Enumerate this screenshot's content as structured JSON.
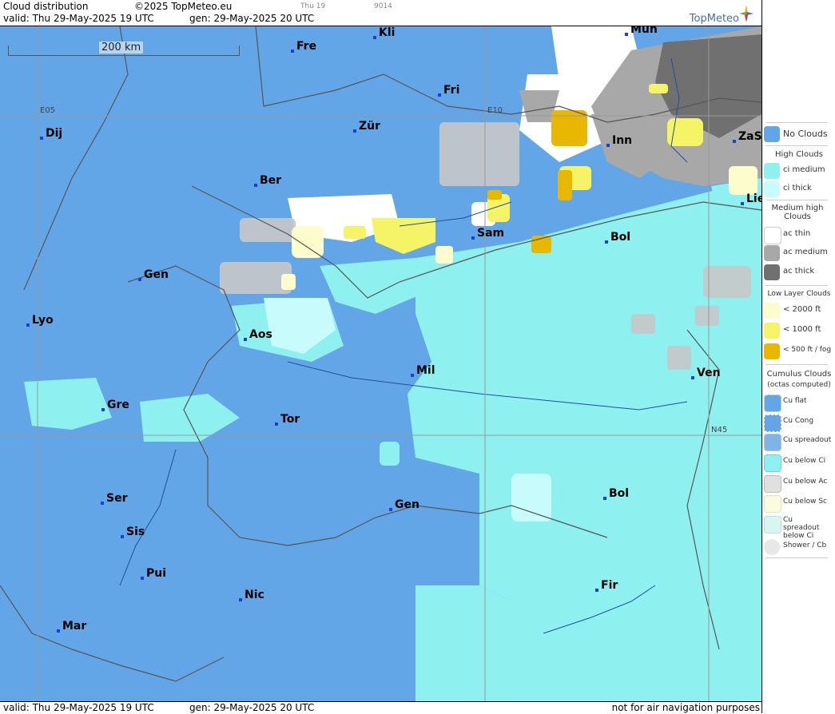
{
  "header": {
    "title": "Cloud distribution",
    "copyright": "©2025 TopMeteo.eu",
    "day_tag": "Thu 19",
    "code": "9014",
    "valid": "valid:  Thu  29-May-2025  19 UTC",
    "gen": "gen: 29-May-2025 20 UTC",
    "brand": "TopMeteo"
  },
  "footer": {
    "valid": "valid:  Thu  29-May-2025  19 UTC",
    "gen": "gen: 29-May-2025 20 UTC",
    "disclaimer": "not for air navigation purposes"
  },
  "map": {
    "scale_label": "200 km",
    "grid_labels": [
      "E05",
      "E10",
      "N45"
    ],
    "cities": [
      "Kli",
      "Mün",
      "Fre",
      "Fri",
      "Dij",
      "Zür",
      "Inn",
      "ZaS",
      "Ber",
      "Lie",
      "Sam",
      "Bol",
      "Gen",
      "Lyo",
      "Aos",
      "Mil",
      "Ven",
      "Gre",
      "Tor",
      "Gen",
      "Bol",
      "Ser",
      "Sis",
      "Pui",
      "Nic",
      "Fir",
      "Mar"
    ]
  },
  "legend": {
    "no_clouds": "No Clouds",
    "high_clouds": "High Clouds",
    "ci_medium": "ci medium",
    "ci_thick": "ci thick",
    "medium_high_clouds": "Medium high Clouds",
    "ac_thin": "ac thin",
    "ac_medium": "ac medium",
    "ac_thick": "ac thick",
    "low_layer_clouds": "Low Layer Clouds",
    "low_2000": "< 2000 ft",
    "low_1000": "< 1000 ft",
    "low_500": "< 500 ft / fog",
    "cumulus_clouds": "Cumulus Clouds",
    "octas_computed": "(octas computed)",
    "cu_flat": "Cu flat",
    "cu_cong": "Cu Cong",
    "cu_spreadout": "Cu spreadout",
    "cu_below_ci": "Cu below Ci",
    "cu_below_ac": "Cu below Ac",
    "cu_below_sc": "Cu below Sc",
    "cu_spreadout_below_ci": "Cu spreadout below Ci",
    "shower_cb": "Shower / Cb"
  },
  "colors": {
    "no_clouds": "#63a6e8",
    "ci_medium": "#8ff0f0",
    "ci_thick": "#c8fbfb",
    "ac_thin": "#ffffff",
    "ac_medium": "#a8a8a8",
    "ac_thick": "#707070",
    "low_2000": "#fcfccc",
    "low_1000": "#f4f466",
    "low_500": "#e8b800"
  }
}
